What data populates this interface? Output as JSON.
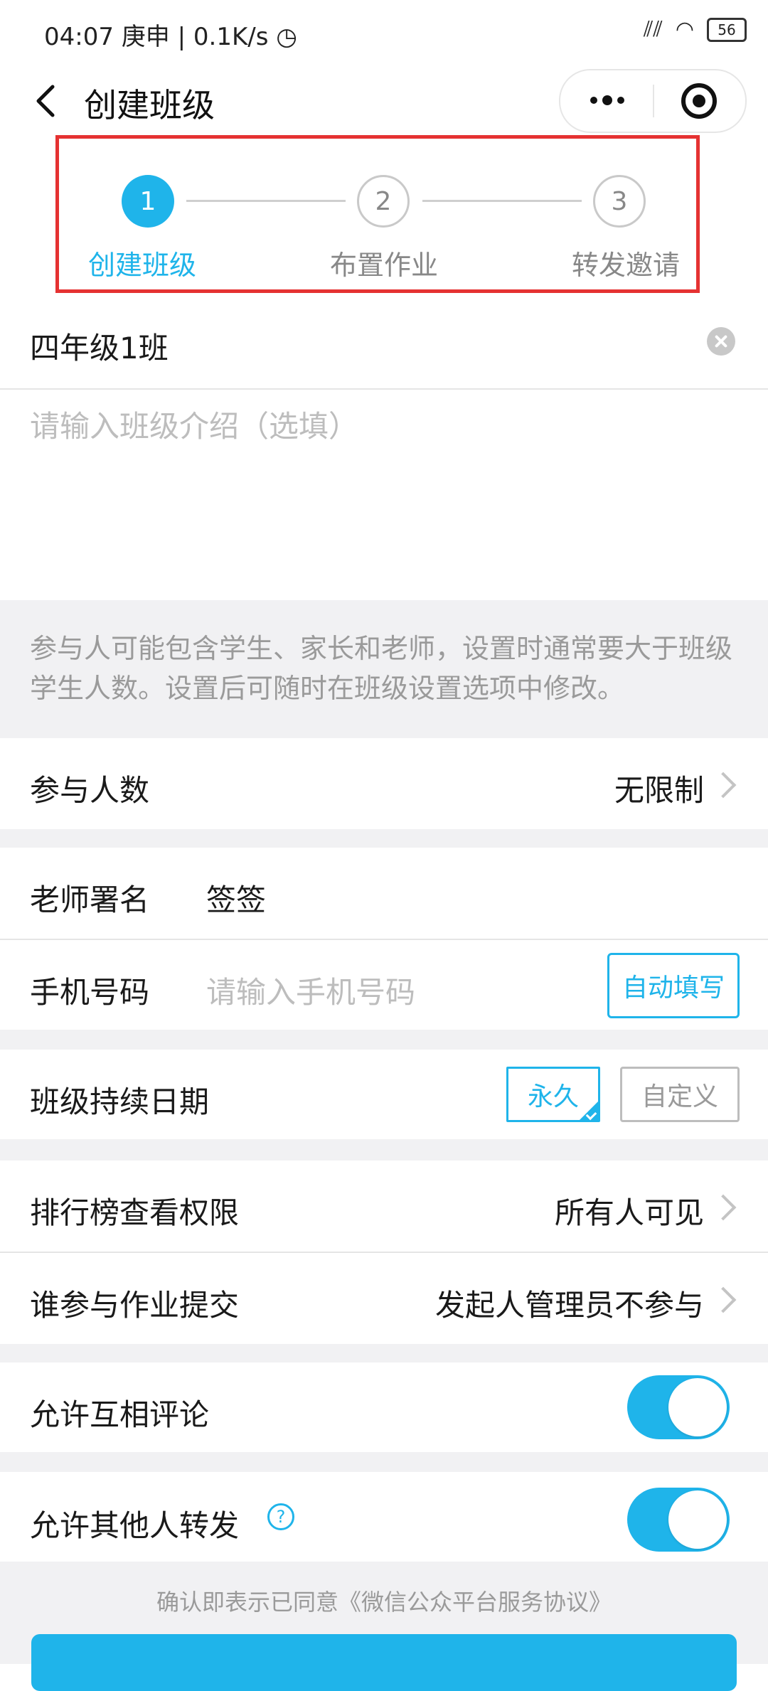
{
  "status_bar": {
    "time": "04:07",
    "date": "庚申",
    "network_speed": "0.1K/s",
    "battery": "56"
  },
  "header": {
    "title": "创建班级",
    "back_icon": "back-arrow-icon",
    "more_icon": "more-dots-icon",
    "close_icon": "target-circle-icon"
  },
  "stepper": {
    "steps": [
      {
        "number": "1",
        "label": "创建班级",
        "active": true
      },
      {
        "number": "2",
        "label": "布置作业",
        "active": false
      },
      {
        "number": "3",
        "label": "转发邀请",
        "active": false
      }
    ],
    "accent_color": "#1fb4ea",
    "highlight_color": "#e53232"
  },
  "form": {
    "class_name_value": "四年级1班",
    "intro_placeholder": "请输入班级介绍（选填）",
    "participants_note": "参与人可能包含学生、家长和老师，设置时通常要大于班级学生人数。设置后可随时在班级设置选项中修改。",
    "participants_label": "参与人数",
    "participants_value": "无限制",
    "teacher_label": "老师署名",
    "teacher_value": "签签",
    "phone_label": "手机号码",
    "phone_placeholder": "请输入手机号码",
    "autofill_label": "自动填写",
    "duration_label": "班级持续日期",
    "duration_options": [
      "永久",
      "自定义"
    ],
    "duration_selected": "永久",
    "ranking_label": "排行榜查看权限",
    "ranking_value": "所有人可见",
    "submit_label": "谁参与作业提交",
    "submit_value": "发起人管理员不参与",
    "comment_label": "允许互相评论",
    "comment_enabled": true,
    "forward_label": "允许其他人转发",
    "forward_enabled": true,
    "help_icon_text": "?"
  },
  "agreement": "确认即表示已同意《微信公众平台服务协议》"
}
